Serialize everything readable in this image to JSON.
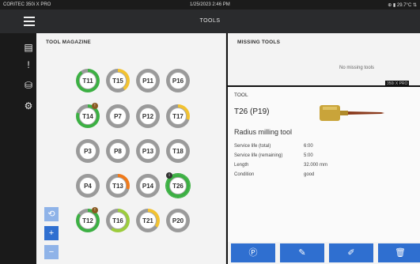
{
  "status": {
    "brand": "CORITEC 350i X PRO",
    "datetime": "1/25/2023 2:46 PM",
    "indicators": "⊕ ▮ 29.7°C ⇅"
  },
  "header": {
    "title": "TOOLS"
  },
  "sidebar": {
    "icons": [
      "menu-icon",
      "document-icon",
      "alert-icon",
      "disk-icon",
      "settings-icon"
    ]
  },
  "magazine": {
    "title": "TOOL MAGAZINE",
    "tools": [
      {
        "id": "T11",
        "level": 0.9,
        "color": "#3cb043"
      },
      {
        "id": "T15",
        "level": 0.4,
        "color": "#f2c230"
      },
      {
        "id": "P11",
        "level": 0.0,
        "color": "#888888"
      },
      {
        "id": "P16",
        "level": 0.0,
        "color": "#888888"
      },
      {
        "id": "T14",
        "level": 0.8,
        "color": "#3cb043",
        "badge": "!"
      },
      {
        "id": "P7",
        "level": 0.0,
        "color": "#888888"
      },
      {
        "id": "P12",
        "level": 0.0,
        "color": "#888888"
      },
      {
        "id": "T17",
        "level": 0.3,
        "color": "#f2c230"
      },
      {
        "id": "P3",
        "level": 0.0,
        "color": "#888888"
      },
      {
        "id": "P8",
        "level": 0.0,
        "color": "#888888"
      },
      {
        "id": "P13",
        "level": 0.0,
        "color": "#888888"
      },
      {
        "id": "T18",
        "level": 0.0,
        "color": "#888888"
      },
      {
        "id": "P4",
        "level": 0.0,
        "color": "#888888"
      },
      {
        "id": "T13",
        "level": 0.3,
        "color": "#f07a1a"
      },
      {
        "id": "P14",
        "level": 0.0,
        "color": "#888888"
      },
      {
        "id": "T26",
        "level": 1.0,
        "color": "#3cb043",
        "badge": "i",
        "selected": true
      },
      {
        "id": "T12",
        "level": 0.85,
        "color": "#3cb043",
        "badge": "!"
      },
      {
        "id": "T16",
        "level": 0.6,
        "color": "#9ccc3c"
      },
      {
        "id": "T21",
        "level": 0.35,
        "color": "#f2c230"
      },
      {
        "id": "P20",
        "level": 0.0,
        "color": "#888888"
      }
    ],
    "controls": [
      {
        "name": "rotate-button",
        "label": "⟲",
        "color": "#8fb3e8"
      },
      {
        "name": "add-button",
        "label": "+",
        "color": "#2f6fd0"
      },
      {
        "name": "remove-button",
        "label": "−",
        "color": "#8fb3e8"
      }
    ]
  },
  "missing": {
    "title": "MISSING TOOLS",
    "empty_text": "No missing tools",
    "device_tag": "350i X PRO"
  },
  "tool": {
    "section": "TOOL",
    "id": "T26 (P19)",
    "name": "Radius milling tool",
    "props": [
      {
        "label": "Service life (total)",
        "value": "6:00"
      },
      {
        "label": "Service life (remaining)",
        "value": "5:00"
      },
      {
        "label": "Length",
        "value": "32.000 mm"
      },
      {
        "label": "Condition",
        "value": "good"
      }
    ]
  },
  "actions": [
    {
      "name": "locate-tool-button",
      "icon": "Ⓟ"
    },
    {
      "name": "edit-tool-button",
      "icon": "✎"
    },
    {
      "name": "rename-tool-button",
      "icon": "✐"
    },
    {
      "name": "delete-tool-button",
      "icon": "🗑"
    }
  ]
}
